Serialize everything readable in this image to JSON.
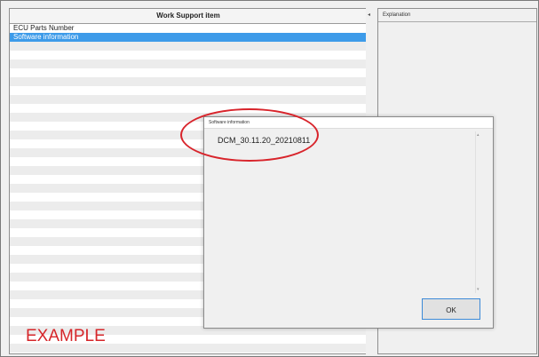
{
  "list": {
    "header": "Work Support item",
    "items": [
      "ECU Parts Number",
      "Software information"
    ],
    "selected_index": 1
  },
  "explanation": {
    "title": "Explanation"
  },
  "dialog": {
    "title": "Software information",
    "value": "DCM_30.11.20_20210811",
    "ok_label": "OK"
  },
  "overlay": {
    "example_label": "EXAMPLE",
    "highlight_color": "#d8242b"
  },
  "colors": {
    "selection": "#3d9be9",
    "accent_border": "#3c8ad8"
  }
}
